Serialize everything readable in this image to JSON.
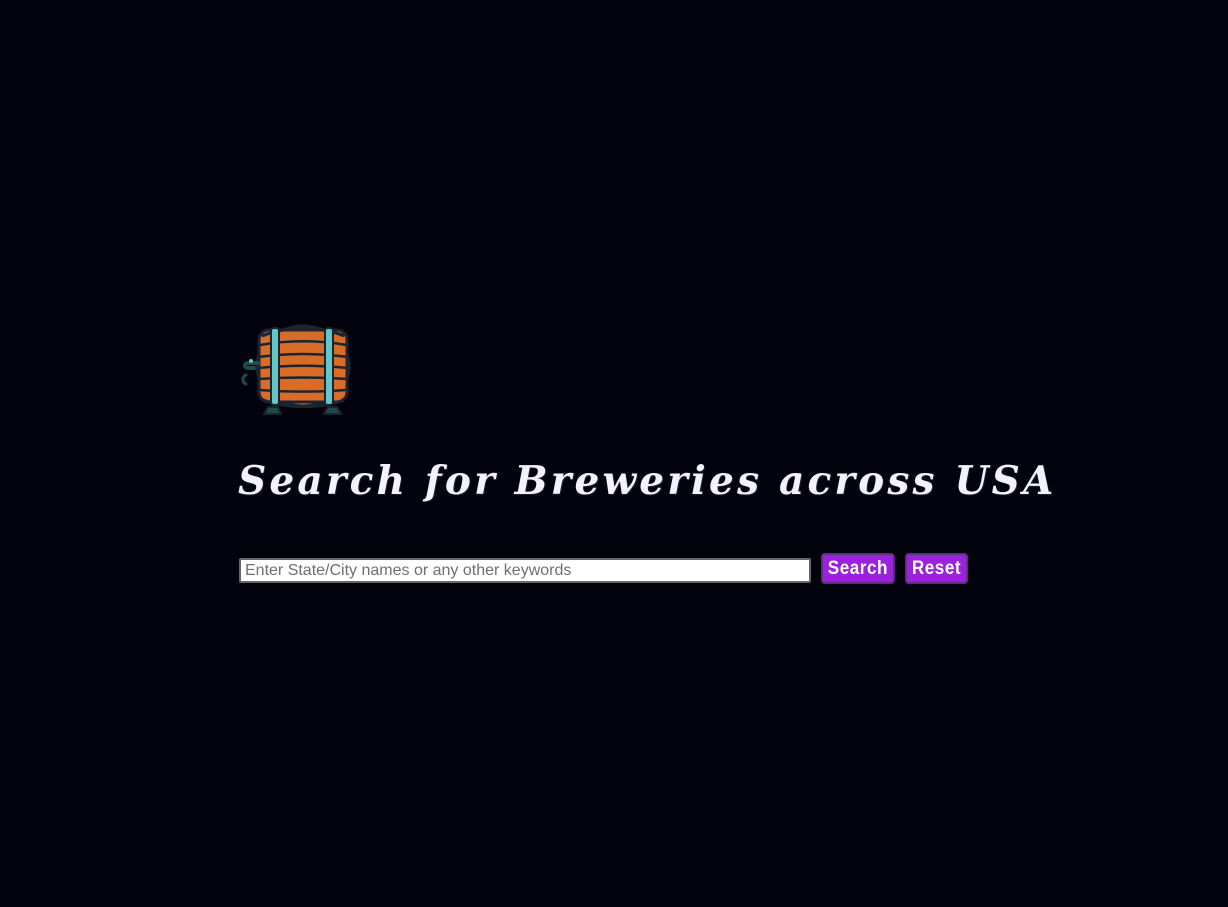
{
  "page": {
    "background": "#03030d"
  },
  "logo": {
    "icon": "beer-barrel-icon",
    "colors": {
      "wood": "#d96d27",
      "bands": "#63c7c8",
      "outline": "#1c2431",
      "tap": "#1f4c4a"
    }
  },
  "title": "Search for Breweries across USA",
  "search": {
    "placeholder": "Enter State/City names or any other keywords",
    "value": "",
    "search_label": "Search",
    "reset_label": "Reset",
    "button_color": "#9b22db"
  }
}
